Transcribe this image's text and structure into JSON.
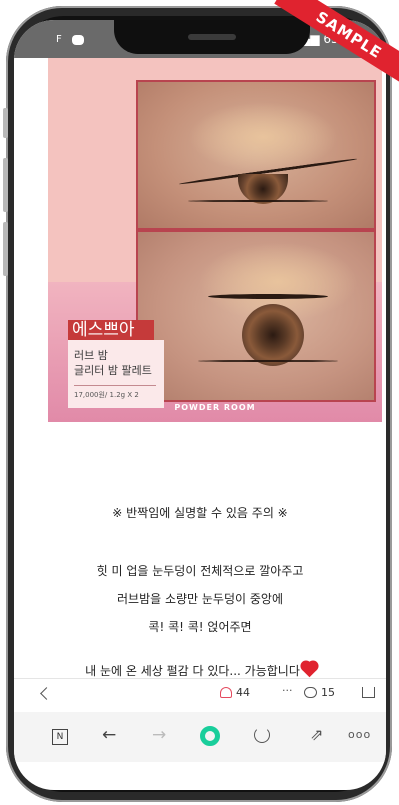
{
  "status_bar": {
    "left_text": "F",
    "battery": "65%"
  },
  "badge": {
    "sample": "SAMPLE"
  },
  "article_image": {
    "brand": "에스쁘아",
    "product_line1": "러브 밤",
    "product_line2": "글리터 밤 팔레트",
    "price": "17,000원/ 1.2g X 2",
    "watermark": "POWDER ROOM"
  },
  "content": {
    "warning": "※ 반짝임에 실명할 수 있음 주의 ※",
    "line1": "힛 미 업을 눈두덩이 전체적으로 깔아주고",
    "line2": "러브밤을 소량만 눈두덩이 중앙에",
    "line3": "콕! 콕! 콕! 얹어주면",
    "line4": "내 눈에 온 세상 펄감 다 있다... 가능합니다"
  },
  "toolbar": {
    "likes": "44",
    "more": "···",
    "comments": "15"
  },
  "navbar": {
    "n_label": "N",
    "back": "←",
    "forward": "→",
    "share": "⇗",
    "menu": "ooo"
  }
}
